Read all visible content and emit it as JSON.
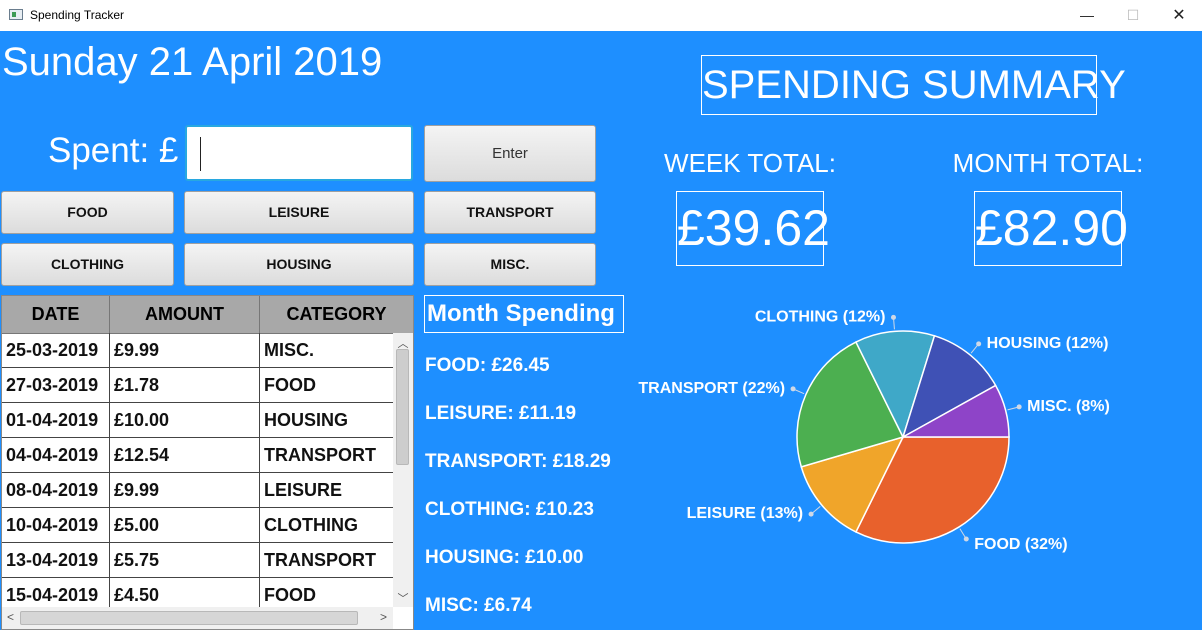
{
  "window": {
    "title": "Spending Tracker",
    "minimize_icon": "—",
    "maximize_icon": "☐",
    "close_icon": "✕"
  },
  "header": {
    "date": "Sunday 21 April 2019"
  },
  "entry": {
    "spent_label": "Spent: £",
    "input_value": "",
    "enter_label": "Enter"
  },
  "categories": {
    "food": "FOOD",
    "leisure": "LEISURE",
    "transport": "TRANSPORT",
    "clothing": "CLOTHING",
    "housing": "HOUSING",
    "misc": "MISC."
  },
  "table": {
    "columns": [
      "DATE",
      "AMOUNT",
      "CATEGORY"
    ],
    "rows": [
      [
        "25-03-2019",
        "£9.99",
        "MISC."
      ],
      [
        "27-03-2019",
        "£1.78",
        "FOOD"
      ],
      [
        "01-04-2019",
        "£10.00",
        "HOUSING"
      ],
      [
        "04-04-2019",
        "£12.54",
        "TRANSPORT"
      ],
      [
        "08-04-2019",
        "£9.99",
        "LEISURE"
      ],
      [
        "10-04-2019",
        "£5.00",
        "CLOTHING"
      ],
      [
        "13-04-2019",
        "£5.75",
        "TRANSPORT"
      ],
      [
        "15-04-2019",
        "£4.50",
        "FOOD"
      ]
    ],
    "scroll_up_icon": "︿",
    "scroll_down_icon": "﹀",
    "scroll_left_icon": "<",
    "scroll_right_icon": ">"
  },
  "month_spending": {
    "title": "Month Spending",
    "lines": [
      "FOOD: £26.45",
      "LEISURE: £11.19",
      "TRANSPORT: £18.29",
      "CLOTHING: £10.23",
      "HOUSING: £10.00",
      "MISC: £6.74"
    ]
  },
  "summary": {
    "title": "SPENDING SUMMARY",
    "week_label": "WEEK TOTAL:",
    "week_value": "£39.62",
    "month_label": "MONTH TOTAL:",
    "month_value": "£82.90"
  },
  "chart_data": {
    "type": "pie",
    "slices": [
      {
        "label": "FOOD (32%)",
        "value": 32,
        "color": "#e8612c"
      },
      {
        "label": "LEISURE (13%)",
        "value": 13,
        "color": "#f0a52a"
      },
      {
        "label": "TRANSPORT (22%)",
        "value": 22,
        "color": "#4caf50"
      },
      {
        "label": "CLOTHING (12%)",
        "value": 12,
        "color": "#3fa8c8"
      },
      {
        "label": "HOUSING (12%)",
        "value": 12,
        "color": "#3f51b5"
      },
      {
        "label": "MISC. (8%)",
        "value": 8,
        "color": "#8e44c8"
      }
    ]
  }
}
